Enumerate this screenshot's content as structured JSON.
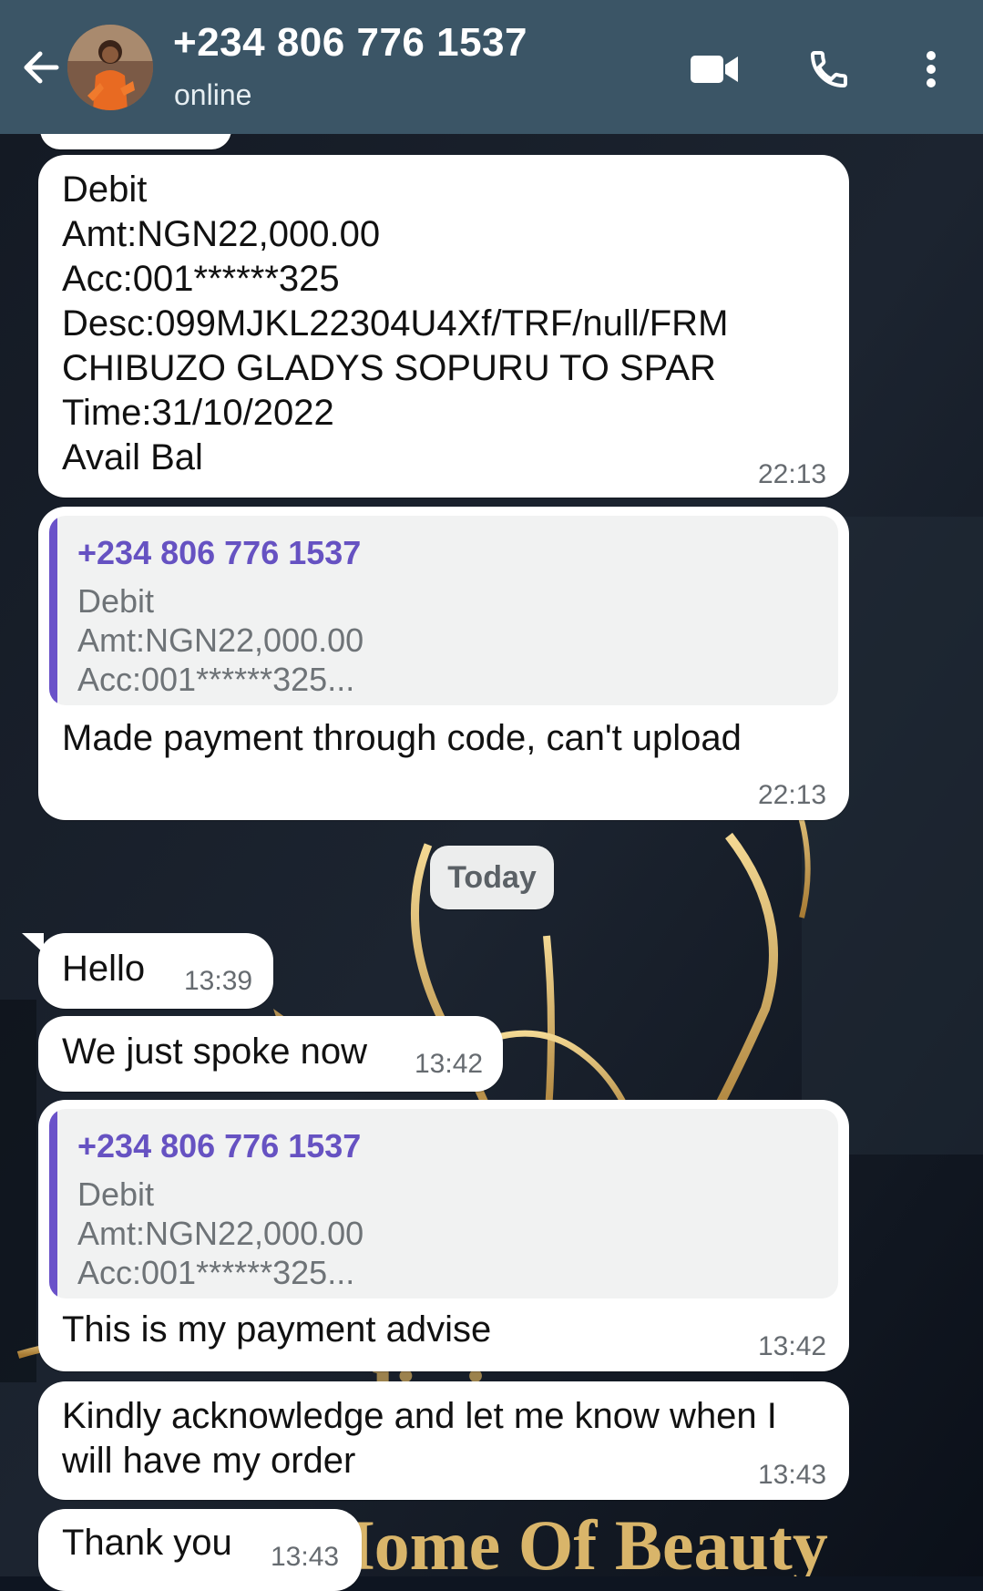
{
  "header": {
    "back_icon": "arrow-left-icon",
    "contact_name": "+234 806 776 1537",
    "status": "online",
    "icons": [
      "video-camera-icon",
      "phone-icon",
      "more-vertical-icon"
    ]
  },
  "messages": [
    {
      "text": "Debit\nAmt:NGN22,000.00\nAcc:001******325\nDesc:099MJKL22304U4Xf/TRF/null/FRM\nCHIBUZO GLADYS SOPURU TO SPAR\nTime:31/10/2022\nAvail Bal",
      "time": "22:13"
    },
    {
      "quote_author": "+234 806 776 1537",
      "quote_text": "Debit\nAmt:NGN22,000.00\nAcc:001******325...",
      "text": "Made payment through code, can't upload",
      "time": "22:13"
    },
    {
      "text": "Hello",
      "time": "13:39"
    },
    {
      "text": "We just spoke now",
      "time": "13:42"
    },
    {
      "quote_author": "+234 806 776 1537",
      "quote_text": "Debit\nAmt:NGN22,000.00\nAcc:001******325...",
      "text": "This is my payment advise",
      "time": "13:42"
    },
    {
      "text": "Kindly acknowledge and let me know when I\nwill have my order",
      "time": "13:43"
    },
    {
      "text": "Thank you",
      "time": "13:43"
    }
  ],
  "date_separator": "Today",
  "wallpaper": {
    "text": "Home Of Beauty"
  },
  "colors": {
    "header_bg": "#3b5566",
    "quote_accent": "#6a52c9",
    "bubble_bg": "#ffffff",
    "wallpaper_gold": "#c9a45a"
  }
}
